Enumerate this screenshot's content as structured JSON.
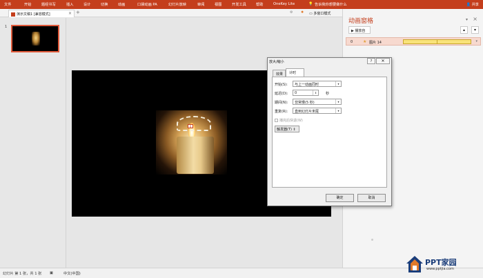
{
  "ribbon": {
    "tabs": [
      "文件",
      "开始",
      "题经书写",
      "插入",
      "设计",
      "切换",
      "动画",
      "口袋动画 PA",
      "幻灯片放映",
      "审阅",
      "视图",
      "开发工具",
      "帮助",
      "OneKey Lite"
    ],
    "tell_me": "告诉我你想要做什么",
    "share": "共享"
  },
  "doc": {
    "tab_label": "演示文稿1 [兼容模式]",
    "close": "×",
    "new_tab": "+",
    "multi_window": "多窗口模式"
  },
  "thumbnails": {
    "slide_number": "1"
  },
  "anim_pane": {
    "title": "动画窗格",
    "play_button": "▶ 播放自",
    "up": "▴",
    "down": "▾",
    "item": {
      "number": "0",
      "label": "图片 14",
      "dropdown": "▾"
    }
  },
  "dialog": {
    "title": "放大/缩小",
    "help": "?",
    "close": "✕",
    "tabs": [
      "效果",
      "计时"
    ],
    "start_label": "开始(S):",
    "start_value": "与上一动画同时",
    "delay_label": "延迟(D):",
    "delay_value": "0",
    "delay_unit": "秒",
    "duration_label": "期间(N):",
    "duration_value": "非常慢(5 秒)",
    "repeat_label": "重复(R):",
    "repeat_value": "直到幻灯片末尾",
    "rewind_label": "播完后快退(W)",
    "trigger_label": "触发器(T) ⇕",
    "ok": "确定",
    "cancel": "取消"
  },
  "status": {
    "slide_info": "幻灯片 第 1 张，共 1 张",
    "language": "中文(中国)"
  },
  "watermark": {
    "brand": "PPT家园",
    "url": "www.pptjia.com"
  },
  "colors": {
    "ribbon": "#c43e1c",
    "accent": "#c43e1c",
    "timeline_bar": "#f9e37a"
  }
}
